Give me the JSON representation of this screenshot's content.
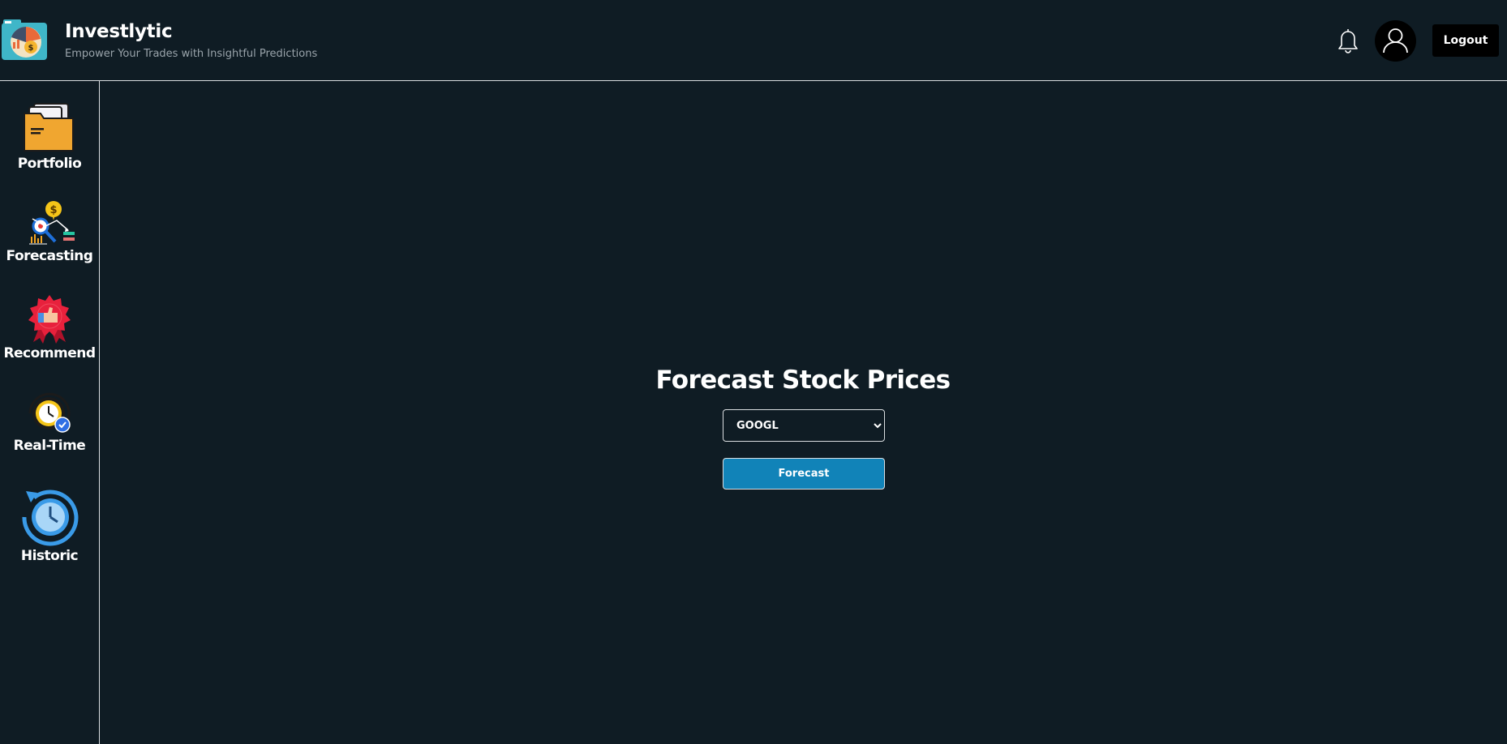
{
  "app": {
    "title": "Investlytic",
    "tagline": "Empower Your Trades with Insightful Predictions"
  },
  "header": {
    "logout_label": "Logout",
    "icons": [
      "app-logo-icon",
      "bell-icon",
      "user-avatar-icon"
    ]
  },
  "sidebar": {
    "items": [
      {
        "label": "Portfolio",
        "icon": "portfolio-folder-icon"
      },
      {
        "label": "Forecasting",
        "icon": "forecasting-chart-icon"
      },
      {
        "label": "Recommend",
        "icon": "recommend-badge-icon"
      },
      {
        "label": "Real-Time",
        "icon": "realtime-clock-icon"
      },
      {
        "label": "Historic",
        "icon": "historic-clock-icon"
      }
    ]
  },
  "main": {
    "title": "Forecast Stock Prices",
    "ticker_selected": "GOOGL",
    "forecast_label": "Forecast"
  },
  "colors": {
    "background": "#0f1c24",
    "accent_button": "#1183b8",
    "border": "#d9dde0",
    "tagline": "#9aa4ab"
  }
}
